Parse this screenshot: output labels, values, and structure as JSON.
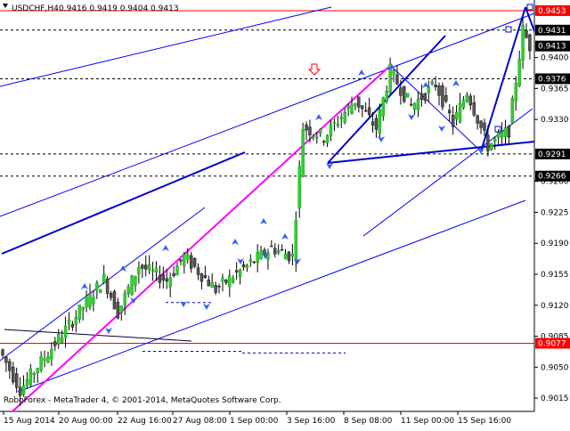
{
  "header": {
    "symbol_label": "USDCHF,H4",
    "ohlc_label": "0.9416 0.9419 0.9404 0.9413"
  },
  "footer": {
    "copyright": "RoboForex - MetaTrader 4, © 2001-2014, MetaQuotes Software Corp."
  },
  "colors": {
    "bull": "#33cc33",
    "bear": "#555555",
    "trendline": "#0000cc",
    "thin_line": "#0000ff",
    "magenta": "#ff00ff",
    "red": "#ff0000",
    "arrow": "#3060ff"
  },
  "chart_data": {
    "type": "candlestick",
    "title": "USDCHF,H4",
    "ylim": [
      0.9,
      0.946
    ],
    "y_ticks": [
      "0.9400",
      "0.9365",
      "0.9330",
      "0.9260",
      "0.9225",
      "0.9190",
      "0.9155",
      "0.9120",
      "0.9085",
      "0.9050",
      "0.9015"
    ],
    "x_ticks": [
      "15 Aug 2014",
      "20 Aug 00:00",
      "22 Aug 16:00",
      "27 Aug 08:00",
      "1 Sep 00:00",
      "3 Sep 16:00",
      "8 Sep 08:00",
      "11 Sep 00:00",
      "15 Sep 16:00"
    ],
    "price_labels": [
      {
        "text": "0.9453",
        "value": 0.9453,
        "color": "#ff0000"
      },
      {
        "text": "0.9431",
        "value": 0.9431,
        "color": "#000000"
      },
      {
        "text": "0.9413",
        "value": 0.9413,
        "color": "#000000"
      },
      {
        "text": "0.9376",
        "value": 0.9376,
        "color": "#000000"
      },
      {
        "text": "0.9291",
        "value": 0.9291,
        "color": "#000000"
      },
      {
        "text": "0.9266",
        "value": 0.9266,
        "color": "#000000"
      },
      {
        "text": "0.9077",
        "value": 0.9077,
        "color": "#ff0000"
      }
    ],
    "horizontal_levels": [
      {
        "value": 0.9453,
        "style": "solid",
        "color": "#ff0000"
      },
      {
        "value": 0.9431,
        "style": "dashed",
        "color": "#000000"
      },
      {
        "value": 0.9376,
        "style": "dashed",
        "color": "#000000"
      },
      {
        "value": 0.9291,
        "style": "dashed",
        "color": "#000000"
      },
      {
        "value": 0.9266,
        "style": "dashed",
        "color": "#000000"
      },
      {
        "value": 0.9077,
        "style": "solid",
        "color": "#ff0000"
      }
    ],
    "candle_series": [
      {
        "from_bar": 0,
        "from_price": 0.907,
        "to_bar": 6,
        "to_price": 0.9025
      },
      {
        "from_bar": 6,
        "from_price": 0.9025,
        "to_bar": 22,
        "to_price": 0.9108
      },
      {
        "from_bar": 22,
        "from_price": 0.9108,
        "to_bar": 30,
        "to_price": 0.915
      },
      {
        "from_bar": 30,
        "from_price": 0.915,
        "to_bar": 34,
        "to_price": 0.9112
      },
      {
        "from_bar": 34,
        "from_price": 0.9112,
        "to_bar": 40,
        "to_price": 0.9165
      },
      {
        "from_bar": 40,
        "from_price": 0.9165,
        "to_bar": 48,
        "to_price": 0.9148
      },
      {
        "from_bar": 48,
        "from_price": 0.9148,
        "to_bar": 53,
        "to_price": 0.9175
      },
      {
        "from_bar": 53,
        "from_price": 0.9175,
        "to_bar": 62,
        "to_price": 0.9138
      },
      {
        "from_bar": 62,
        "from_price": 0.9138,
        "to_bar": 78,
        "to_price": 0.9185
      },
      {
        "from_bar": 78,
        "from_price": 0.9185,
        "to_bar": 84,
        "to_price": 0.9175
      },
      {
        "from_bar": 84,
        "from_price": 0.9175,
        "to_bar": 87,
        "to_price": 0.9322
      },
      {
        "from_bar": 87,
        "from_price": 0.9322,
        "to_bar": 93,
        "to_price": 0.931
      },
      {
        "from_bar": 93,
        "from_price": 0.931,
        "to_bar": 102,
        "to_price": 0.9352
      },
      {
        "from_bar": 102,
        "from_price": 0.9352,
        "to_bar": 108,
        "to_price": 0.932
      },
      {
        "from_bar": 108,
        "from_price": 0.932,
        "to_bar": 112,
        "to_price": 0.9385
      },
      {
        "from_bar": 112,
        "from_price": 0.9385,
        "to_bar": 118,
        "to_price": 0.9345
      },
      {
        "from_bar": 118,
        "from_price": 0.9345,
        "to_bar": 125,
        "to_price": 0.937
      },
      {
        "from_bar": 125,
        "from_price": 0.937,
        "to_bar": 130,
        "to_price": 0.9325
      },
      {
        "from_bar": 130,
        "from_price": 0.9325,
        "to_bar": 134,
        "to_price": 0.9362
      },
      {
        "from_bar": 134,
        "from_price": 0.9362,
        "to_bar": 140,
        "to_price": 0.93
      },
      {
        "from_bar": 140,
        "from_price": 0.93,
        "to_bar": 146,
        "to_price": 0.9318
      },
      {
        "from_bar": 146,
        "from_price": 0.9318,
        "to_bar": 150,
        "to_price": 0.9431
      },
      {
        "from_bar": 150,
        "from_price": 0.9431,
        "to_bar": 152,
        "to_price": 0.9413
      }
    ]
  }
}
